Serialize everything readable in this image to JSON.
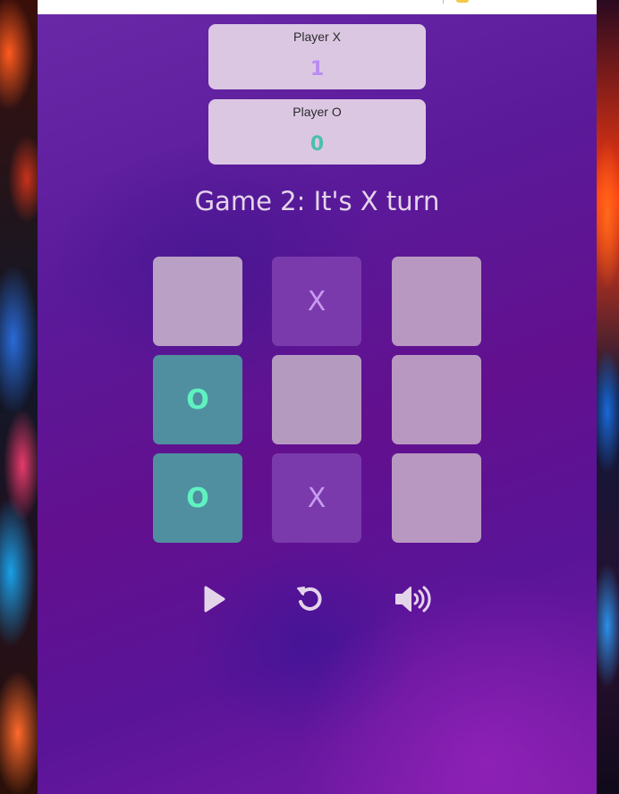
{
  "players": {
    "x": {
      "label": "Player X",
      "score": "1"
    },
    "o": {
      "label": "Player O",
      "score": "0"
    }
  },
  "status": "Game 2: It's X turn",
  "board": [
    [
      "",
      "X",
      ""
    ],
    [
      "O",
      "",
      ""
    ],
    [
      "O",
      "X",
      ""
    ]
  ],
  "controls": {
    "play": "play-icon",
    "restart": "restart-icon",
    "sound": "volume-icon"
  },
  "colors": {
    "x_mark": "#c89bf0",
    "o_mark": "#5ff2c0",
    "x_score": "#b98cf0",
    "o_score": "#4bc0a8"
  }
}
